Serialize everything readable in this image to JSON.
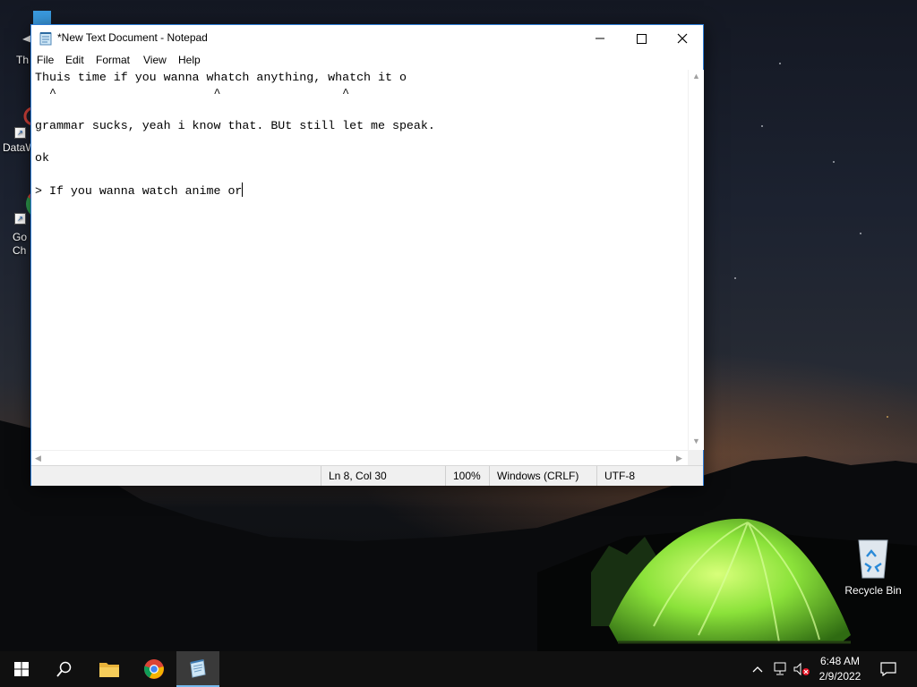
{
  "desktop": {
    "icons": [
      {
        "label": "Th",
        "icon": "this-pc-icon"
      },
      {
        "label": "DataW",
        "icon": "datawrapper-icon"
      },
      {
        "label": "Go\nCh",
        "icon": "chrome-icon"
      },
      {
        "label": "Recycle Bin",
        "icon": "recycle-bin-icon"
      }
    ]
  },
  "notepad": {
    "title": "*New Text Document - Notepad",
    "menu": [
      "File",
      "Edit",
      "Format",
      "View",
      "Help"
    ],
    "lines": [
      "Thuis time if you wanna whatch anything, whatch it o",
      "  ^                      ^                 ^",
      "",
      "grammar sucks, yeah i know that. BUt still let me speak.",
      "",
      "ok",
      "",
      "> If you wanna watch anime or"
    ],
    "status": {
      "position": "Ln 8, Col 30",
      "zoom": "100%",
      "line_ending": "Windows (CRLF)",
      "encoding": "UTF-8"
    }
  },
  "taskbar": {
    "apps": [
      "start-icon",
      "search-icon",
      "file-explorer-icon",
      "chrome-icon",
      "notepad-icon"
    ],
    "active_app": "notepad-icon",
    "time": "6:48 AM",
    "date": "2/9/2022",
    "tray": [
      "chevron-up-icon",
      "network-icon",
      "volume-muted-icon",
      "notification-icon"
    ]
  },
  "colors": {
    "window_border": "#2b7bd6",
    "taskbar_bg": "#101010",
    "active_indicator": "#76b9ed",
    "tent_green": "#8be23a"
  }
}
